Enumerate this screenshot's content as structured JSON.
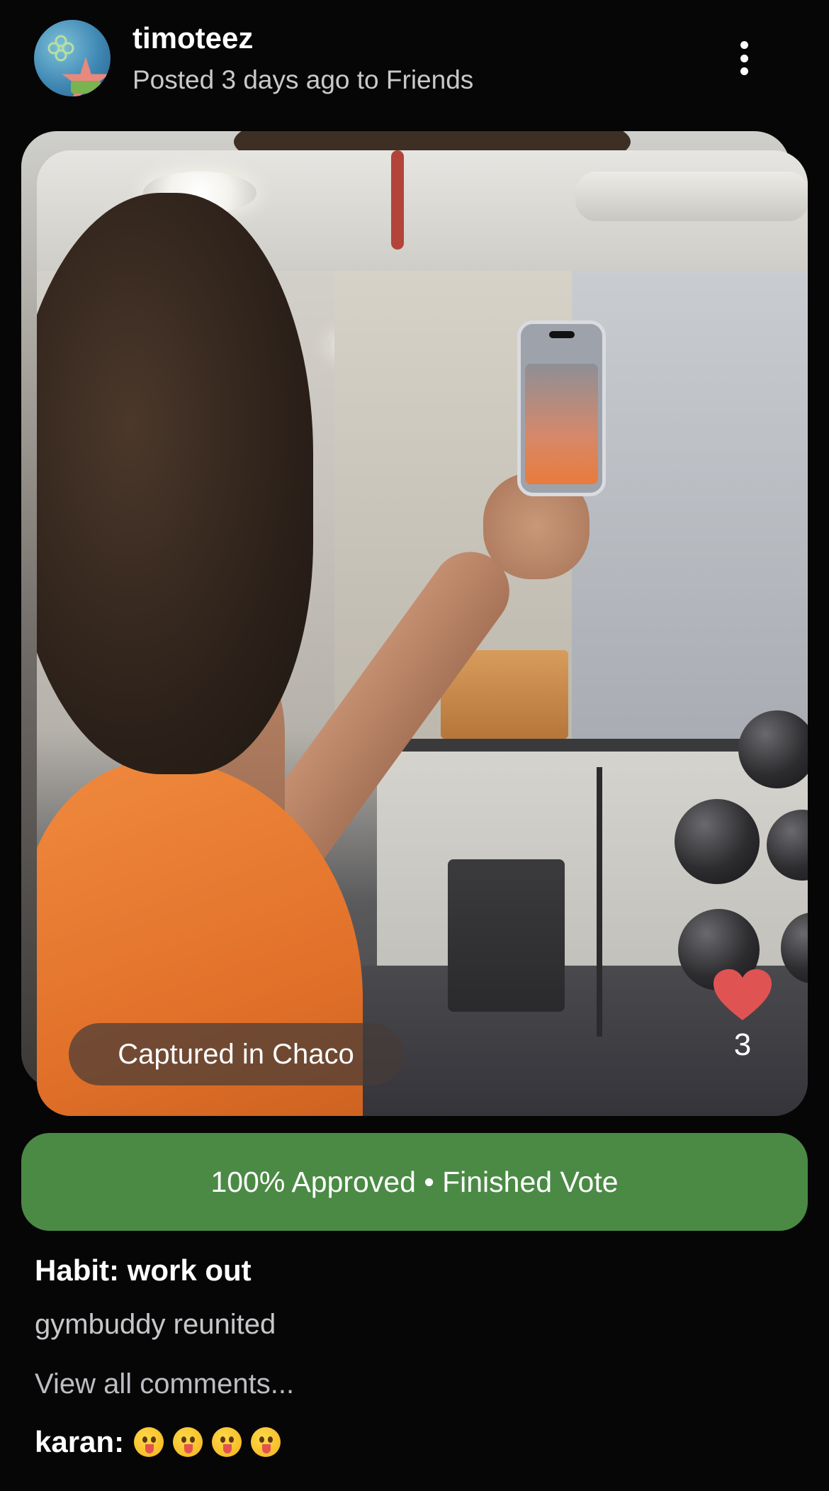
{
  "header": {
    "username": "timoteez",
    "subline": "Posted 3 days ago to Friends",
    "avatar_icon": "avatar-image",
    "more_icon": "more-vertical-icon"
  },
  "photo": {
    "location_label": "Captured in Chaco",
    "like_icon": "heart-icon",
    "like_count": "3",
    "heart_color": "#e05353"
  },
  "vote": {
    "label": "100% Approved • Finished Vote",
    "color": "#4b8a45"
  },
  "details": {
    "habit": "Habit: work out",
    "caption": "gymbuddy reunited",
    "view_comments": "View all comments..."
  },
  "comments": [
    {
      "author": "karan:",
      "emoji_icon": "tongue-out-emoji-icon",
      "emoji_count": 4
    }
  ]
}
